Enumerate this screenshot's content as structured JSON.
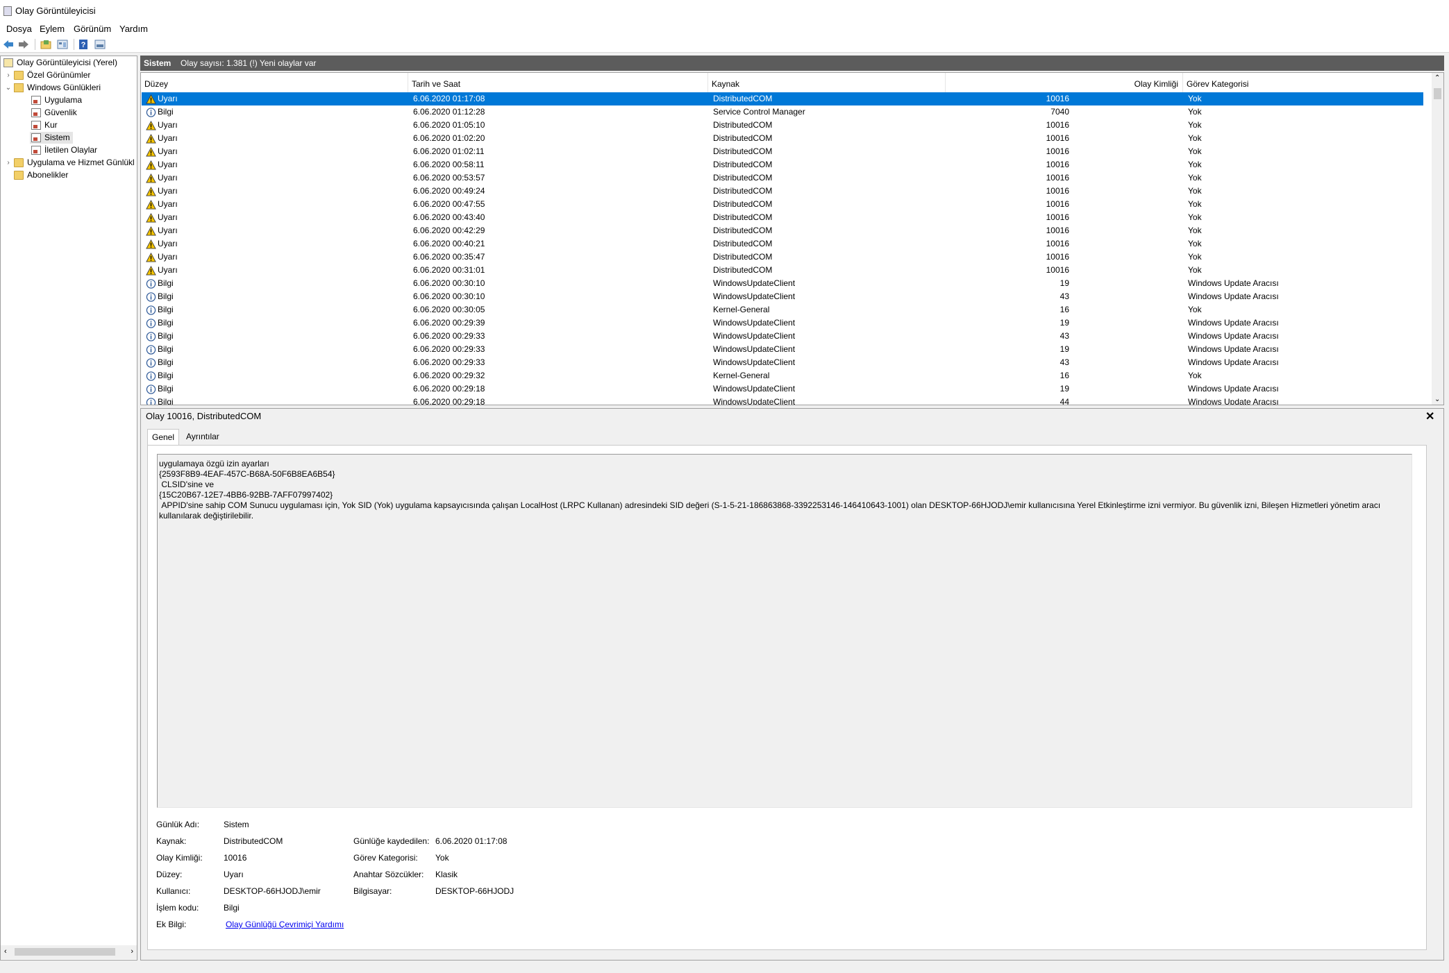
{
  "window": {
    "title": "Olay Görüntüleyicisi"
  },
  "menu": [
    "Dosya",
    "Eylem",
    "Görünüm",
    "Yardım"
  ],
  "tree": {
    "root": "Olay Görüntüleyicisi (Yerel)",
    "custom_views": "Özel Görünümler",
    "windows_logs": "Windows Günlükleri",
    "logs": [
      "Uygulama",
      "Güvenlik",
      "Kur",
      "Sistem",
      "İletilen Olaylar"
    ],
    "app_service_logs": "Uygulama ve Hizmet Günlükl",
    "subscriptions": "Abonelikler",
    "selected": "Sistem"
  },
  "header": {
    "log_name": "Sistem",
    "summary": "Olay sayısı: 1.381 (!) Yeni olaylar var"
  },
  "columns": [
    "Düzey",
    "Tarih ve Saat",
    "Kaynak",
    "Olay Kimliği",
    "Görev Kategorisi"
  ],
  "rows": [
    {
      "level": "Uyarı",
      "type": "warning",
      "date": "6.06.2020 01:17:08",
      "source": "DistributedCOM",
      "id": "10016",
      "category": "Yok"
    },
    {
      "level": "Bilgi",
      "type": "info",
      "date": "6.06.2020 01:12:28",
      "source": "Service Control Manager",
      "id": "7040",
      "category": "Yok"
    },
    {
      "level": "Uyarı",
      "type": "warning",
      "date": "6.06.2020 01:05:10",
      "source": "DistributedCOM",
      "id": "10016",
      "category": "Yok"
    },
    {
      "level": "Uyarı",
      "type": "warning",
      "date": "6.06.2020 01:02:20",
      "source": "DistributedCOM",
      "id": "10016",
      "category": "Yok"
    },
    {
      "level": "Uyarı",
      "type": "warning",
      "date": "6.06.2020 01:02:11",
      "source": "DistributedCOM",
      "id": "10016",
      "category": "Yok"
    },
    {
      "level": "Uyarı",
      "type": "warning",
      "date": "6.06.2020 00:58:11",
      "source": "DistributedCOM",
      "id": "10016",
      "category": "Yok"
    },
    {
      "level": "Uyarı",
      "type": "warning",
      "date": "6.06.2020 00:53:57",
      "source": "DistributedCOM",
      "id": "10016",
      "category": "Yok"
    },
    {
      "level": "Uyarı",
      "type": "warning",
      "date": "6.06.2020 00:49:24",
      "source": "DistributedCOM",
      "id": "10016",
      "category": "Yok"
    },
    {
      "level": "Uyarı",
      "type": "warning",
      "date": "6.06.2020 00:47:55",
      "source": "DistributedCOM",
      "id": "10016",
      "category": "Yok"
    },
    {
      "level": "Uyarı",
      "type": "warning",
      "date": "6.06.2020 00:43:40",
      "source": "DistributedCOM",
      "id": "10016",
      "category": "Yok"
    },
    {
      "level": "Uyarı",
      "type": "warning",
      "date": "6.06.2020 00:42:29",
      "source": "DistributedCOM",
      "id": "10016",
      "category": "Yok"
    },
    {
      "level": "Uyarı",
      "type": "warning",
      "date": "6.06.2020 00:40:21",
      "source": "DistributedCOM",
      "id": "10016",
      "category": "Yok"
    },
    {
      "level": "Uyarı",
      "type": "warning",
      "date": "6.06.2020 00:35:47",
      "source": "DistributedCOM",
      "id": "10016",
      "category": "Yok"
    },
    {
      "level": "Uyarı",
      "type": "warning",
      "date": "6.06.2020 00:31:01",
      "source": "DistributedCOM",
      "id": "10016",
      "category": "Yok"
    },
    {
      "level": "Bilgi",
      "type": "info",
      "date": "6.06.2020 00:30:10",
      "source": "WindowsUpdateClient",
      "id": "19",
      "category": "Windows Update Aracısı"
    },
    {
      "level": "Bilgi",
      "type": "info",
      "date": "6.06.2020 00:30:10",
      "source": "WindowsUpdateClient",
      "id": "43",
      "category": "Windows Update Aracısı"
    },
    {
      "level": "Bilgi",
      "type": "info",
      "date": "6.06.2020 00:30:05",
      "source": "Kernel-General",
      "id": "16",
      "category": "Yok"
    },
    {
      "level": "Bilgi",
      "type": "info",
      "date": "6.06.2020 00:29:39",
      "source": "WindowsUpdateClient",
      "id": "19",
      "category": "Windows Update Aracısı"
    },
    {
      "level": "Bilgi",
      "type": "info",
      "date": "6.06.2020 00:29:33",
      "source": "WindowsUpdateClient",
      "id": "43",
      "category": "Windows Update Aracısı"
    },
    {
      "level": "Bilgi",
      "type": "info",
      "date": "6.06.2020 00:29:33",
      "source": "WindowsUpdateClient",
      "id": "19",
      "category": "Windows Update Aracısı"
    },
    {
      "level": "Bilgi",
      "type": "info",
      "date": "6.06.2020 00:29:33",
      "source": "WindowsUpdateClient",
      "id": "43",
      "category": "Windows Update Aracısı"
    },
    {
      "level": "Bilgi",
      "type": "info",
      "date": "6.06.2020 00:29:32",
      "source": "Kernel-General",
      "id": "16",
      "category": "Yok"
    },
    {
      "level": "Bilgi",
      "type": "info",
      "date": "6.06.2020 00:29:18",
      "source": "WindowsUpdateClient",
      "id": "19",
      "category": "Windows Update Aracısı"
    },
    {
      "level": "Bilgi",
      "type": "info",
      "date": "6.06.2020 00:29:18",
      "source": "WindowsUpdateClient",
      "id": "44",
      "category": "Windows Update Aracısı"
    }
  ],
  "detail": {
    "title": "Olay 10016, DistributedCOM",
    "tabs": [
      "Genel",
      "Ayrıntılar"
    ],
    "message_lines": [
      "uygulamaya özgü izin ayarları",
      "{2593F8B9-4EAF-457C-B68A-50F6B8EA6B54}",
      " CLSID'sine ve",
      "{15C20B67-12E7-4BB6-92BB-7AFF07997402}",
      " APPID'sine sahip COM Sunucu uygulaması için, Yok SID (Yok) uygulama kapsayıcısında çalışan LocalHost (LRPC Kullanan) adresindeki SID değeri (S-1-5-21-186863868-3392253146-146410643-1001) olan DESKTOP-66HJODJ\\emir kullanıcısına Yerel Etkinleştirme izni vermiyor. Bu güvenlik izni, Bileşen Hizmetleri yönetim aracı kullanılarak değiştirilebilir."
    ],
    "props_left": [
      {
        "label": "Günlük Adı:",
        "value": "Sistem"
      },
      {
        "label": "Kaynak:",
        "value": "DistributedCOM"
      },
      {
        "label": "Olay Kimliği:",
        "value": "10016"
      },
      {
        "label": "Düzey:",
        "value": "Uyarı"
      },
      {
        "label": "Kullanıcı:",
        "value": "DESKTOP-66HJODJ\\emir"
      },
      {
        "label": "İşlem kodu:",
        "value": "Bilgi"
      }
    ],
    "props_right": [
      {
        "label": "Günlüğe kaydedilen:",
        "value": "6.06.2020 01:17:08"
      },
      {
        "label": "Görev Kategorisi:",
        "value": "Yok"
      },
      {
        "label": "Anahtar Sözcükler:",
        "value": "Klasik"
      },
      {
        "label": "Bilgisayar:",
        "value": "DESKTOP-66HJODJ"
      }
    ],
    "more_info_label": "Ek Bilgi:",
    "more_info_link": "Olay Günlüğü Çevrimiçi Yardımı"
  },
  "colors": {
    "selection": "#0078d7",
    "header_bar": "#5c5c5c",
    "warning": "#f5c400",
    "info": "#2b5797"
  },
  "icons": [
    "back-icon",
    "forward-icon",
    "open-icon",
    "properties-icon",
    "help-icon",
    "preview-icon",
    "warning-icon",
    "info-icon",
    "close-icon"
  ]
}
